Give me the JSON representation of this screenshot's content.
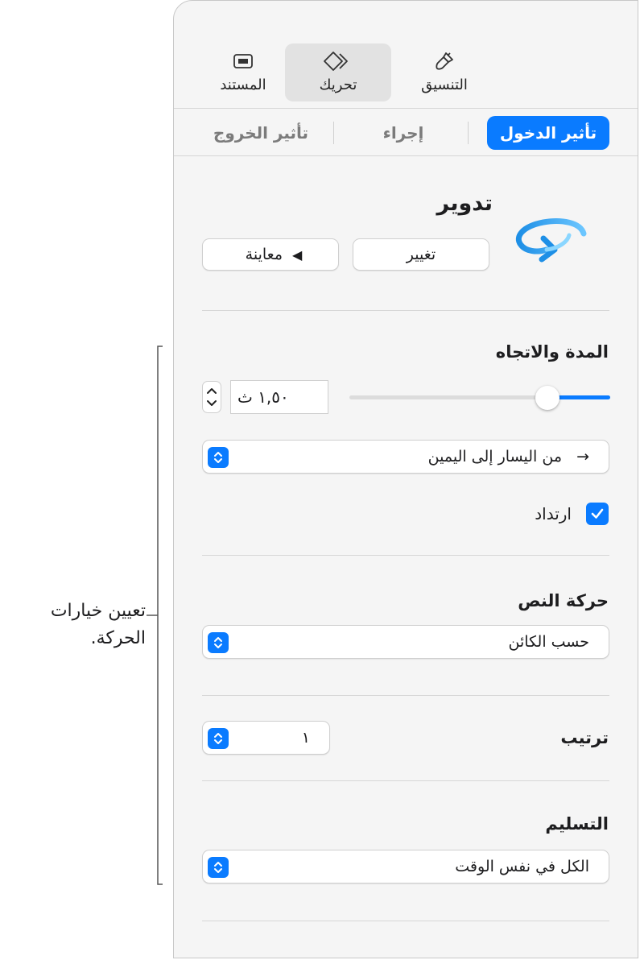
{
  "toolbar": {
    "format_label": "التنسيق",
    "animate_label": "تحريك",
    "document_label": "المستند"
  },
  "tabs": {
    "build_in": "تأثير الدخول",
    "action": "إجراء",
    "build_out": "تأثير الخروج"
  },
  "effect": {
    "name": "تدوير",
    "change_label": "تغيير",
    "preview_label": "معاينة"
  },
  "duration": {
    "title": "المدة والاتجاه",
    "value_text": "١,٥٠ ث",
    "slider_value_percent": 76,
    "direction_text": "من اليسار إلى اليمين",
    "direction_arrow": "→",
    "bounce_label": "ارتداد",
    "bounce_checked": true
  },
  "text_animation": {
    "title": "حركة النص",
    "value": "حسب الكائن"
  },
  "order": {
    "title": "ترتيب",
    "value": "١"
  },
  "delivery": {
    "title": "التسليم",
    "value": "الكل في نفس الوقت"
  },
  "callout": {
    "line1": "تعيين خيارات",
    "line2": "الحركة."
  },
  "colors": {
    "accent": "#0a7bff",
    "panel_bg": "#f5f5f5"
  },
  "icons": {
    "format": "paintbrush-icon",
    "animate": "diamond-icon",
    "document": "document-icon",
    "effect": "rotate-arrow-icon",
    "preview": "play-triangle-icon",
    "popup": "updown-chevron-icon",
    "bounce": "checkmark-icon"
  }
}
